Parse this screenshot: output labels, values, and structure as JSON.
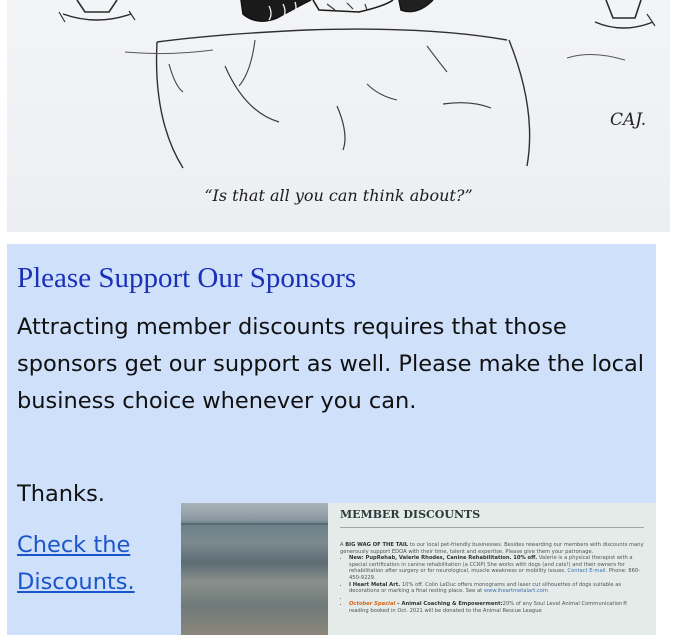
{
  "cartoon": {
    "caption": "“Is that all you can think about?”",
    "signature": "CAJ."
  },
  "sponsors": {
    "heading": "Please Support Our Sponsors",
    "body": "Attracting member discounts requires that those sponsors get our support as well.  Please make the local business choice whenever you can.",
    "thanks": "Thanks.",
    "link": "Check the Discounts."
  },
  "flyer": {
    "title": "MEMBER DISCOUNTS",
    "intro_lead": "A ",
    "intro_bold": "BIG WAG OF THE TAIL",
    "intro_rest": " to our local pet-friendly businesses.  Besides rewarding our members with discounts many generously support EDOA with their time, talent and expertise. Please give them your patronage.",
    "item1_bold": "New: PupRehab, Valerie Rhodes, Canine Rehabilitation.  10% off.",
    "item1_text": " Valerie is a physical therapist with a special certification in canine rehabilitation (a CCRP) She works with dogs (and cats!) and their owners for rehabilitation after surgery or for neurological, muscle weakness or mobility issues. ",
    "item1_link": "Contact E-mail.",
    "item1_phone": " Phone: 860-450-9229.",
    "item2_bold": "I Heart Metal Art.",
    "item2_text": " 10% off. Colin LeDuc offers monograms and laser cut silhouettes of dogs suitable as decorations or marking a final resting place. See at ",
    "item2_link": "www.iheartmetalart.com",
    "item3_accent": "October Special",
    "item3_bold": " – Animal Coaching & Empowerment:",
    "item3_text": "20% of any Soul Level Animal Communication® reading booked in Oct. 2021 will be donated to the Animal Rescue League"
  }
}
